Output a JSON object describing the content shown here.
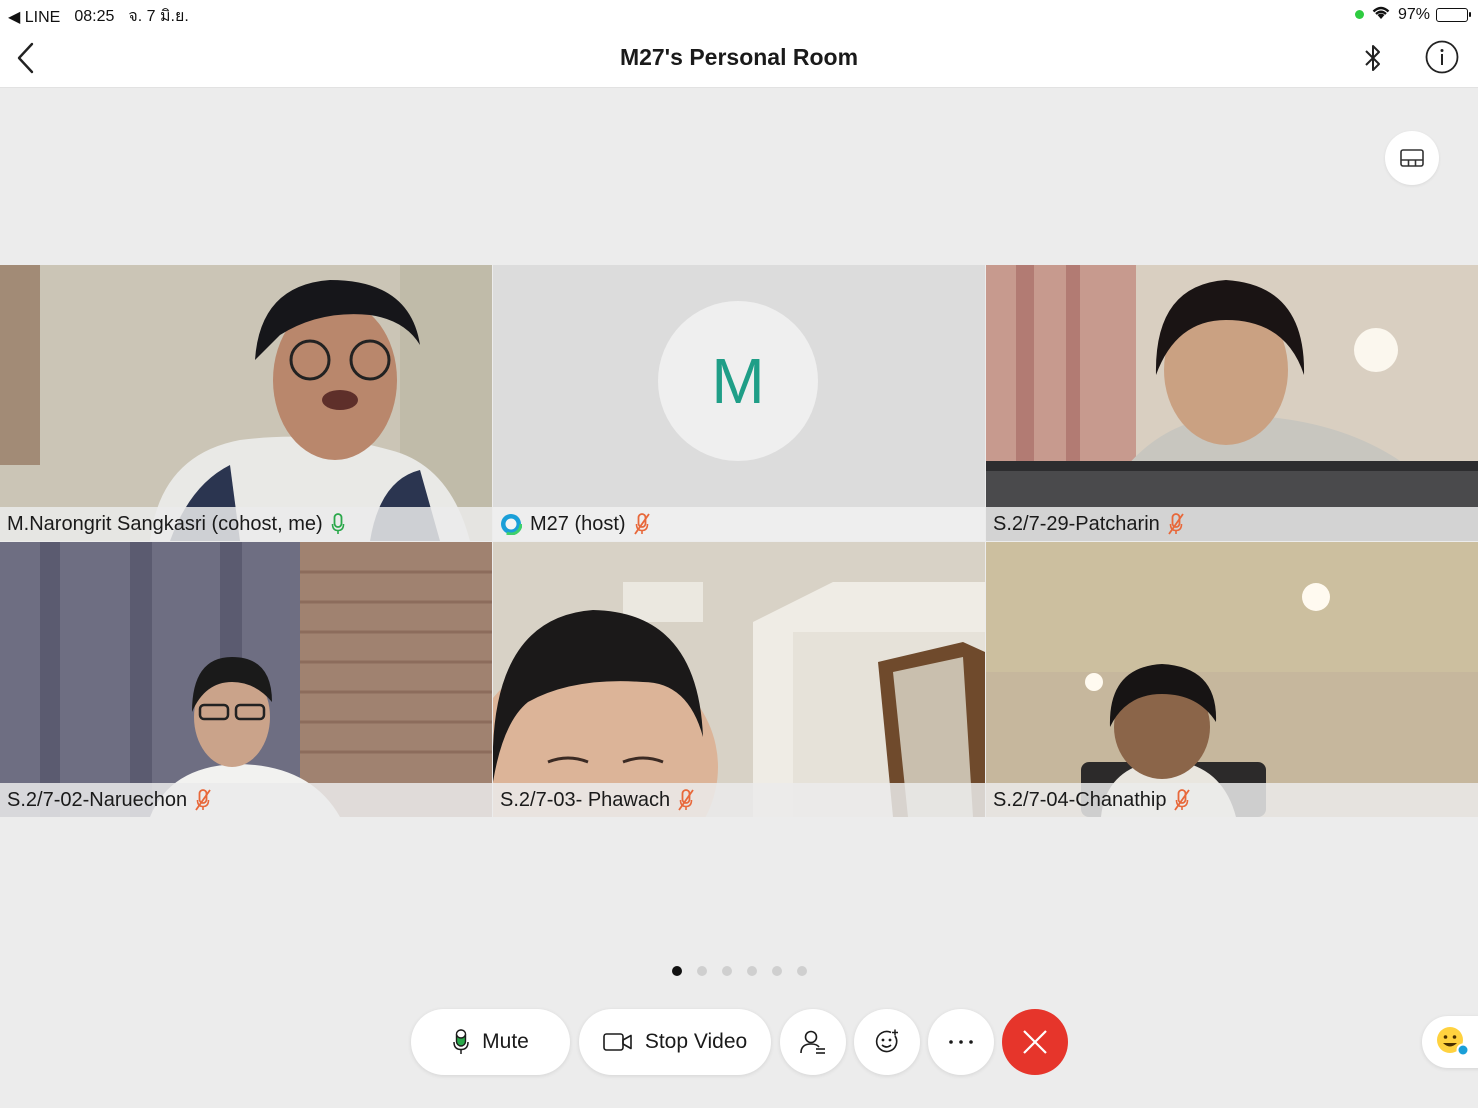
{
  "status_bar": {
    "back_app": "◀ LINE",
    "time": "08:25",
    "date": "จ. 7 มิ.ย.",
    "battery": "97%"
  },
  "nav": {
    "title": "M27's Personal Room"
  },
  "participants": [
    {
      "name": "M.Narongrit Sangkasri (cohost, me)",
      "mic": "on",
      "active": true
    },
    {
      "name": "M27 (host)",
      "mic": "muted",
      "avatar_initial": "M"
    },
    {
      "name": "S.2/7-29-Patcharin",
      "mic": "muted"
    },
    {
      "name": "S.2/7-02-Naruechon",
      "mic": "muted"
    },
    {
      "name": "S.2/7-03- Phawach",
      "mic": "muted"
    },
    {
      "name": "S.2/7-04-Chanathip",
      "mic": "muted"
    }
  ],
  "pagination": {
    "pages": 6,
    "current": 1
  },
  "controls": {
    "mute_label": "Mute",
    "video_label": "Stop Video"
  },
  "colors": {
    "active_border": "#0b7bb5",
    "mic_on": "#2aa84a",
    "mic_muted": "#e8683a",
    "end_call": "#e6352b",
    "avatar_letter": "#1f9e87"
  }
}
